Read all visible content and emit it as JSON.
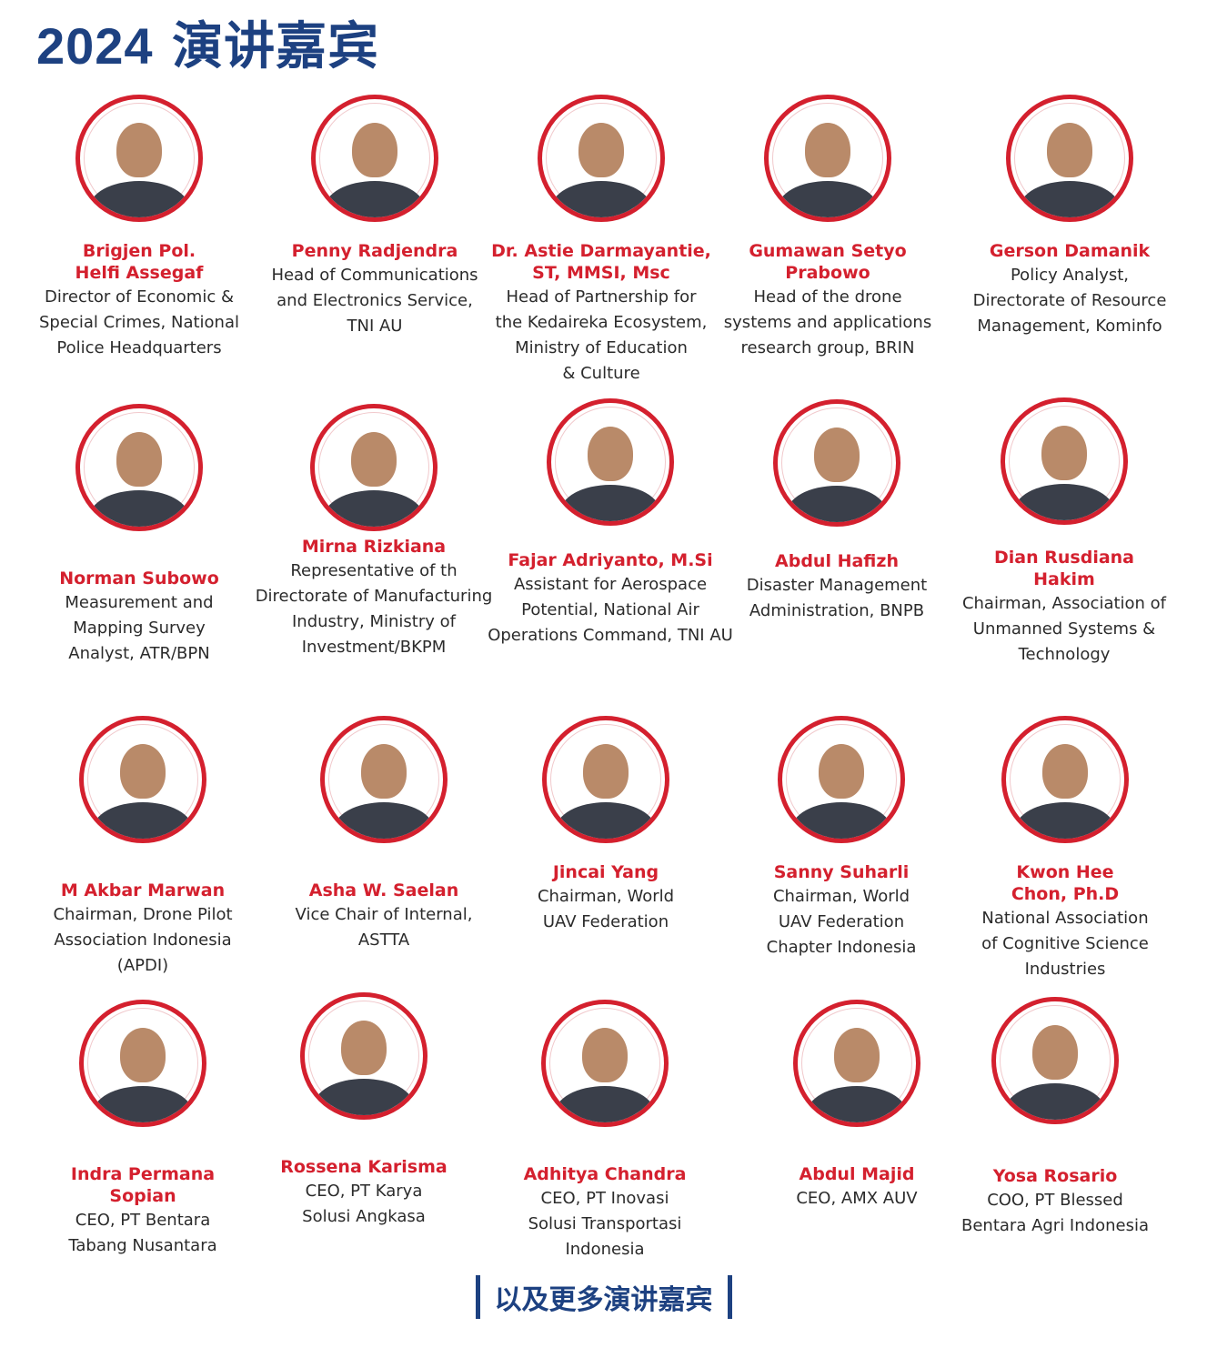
{
  "page": {
    "title_year": "2024",
    "title_text": "演讲嘉宾",
    "footer_text": "以及更多演讲嘉宾"
  },
  "colors": {
    "title": "#1d4181",
    "name": "#d4202e",
    "ring": "#d4202e"
  },
  "speakers": [
    {
      "name": "Brigjen Pol.\nHelfi Assegaf",
      "role": "Director of Economic &\nSpecial Crimes, National\nPolice Headquarters"
    },
    {
      "name": "Penny Radjendra",
      "role": "Head of Communications\nand Electronics Service,\nTNI AU"
    },
    {
      "name": "Dr. Astie Darmayantie,\nST, MMSI, Msc",
      "role": "Head of Partnership for\nthe Kedaireka Ecosystem,\nMinistry of Education\n& Culture"
    },
    {
      "name": "Gumawan Setyo\nPrabowo",
      "role": "Head of the drone\nsystems and applications\nresearch group, BRIN"
    },
    {
      "name": "Gerson Damanik",
      "role": "Policy Analyst,\nDirectorate of Resource\nManagement, Kominfo"
    },
    {
      "name": "Norman Subowo",
      "role": "Measurement and\nMapping Survey\nAnalyst, ATR/BPN"
    },
    {
      "name": "Mirna Rizkiana",
      "role": "Representative of th\nDirectorate of Manufacturing\nIndustry, Ministry of\nInvestment/BKPM"
    },
    {
      "name": "Fajar Adriyanto, M.Si",
      "role": "Assistant for Aerospace\nPotential, National Air\nOperations Command, TNI AU"
    },
    {
      "name": "Abdul Hafizh",
      "role": "Disaster Management\nAdministration, BNPB"
    },
    {
      "name": "Dian Rusdiana\nHakim",
      "role": "Chairman, Association of\nUnmanned Systems &\nTechnology"
    },
    {
      "name": "M Akbar Marwan",
      "role": "Chairman, Drone Pilot\nAssociation Indonesia\n(APDI)"
    },
    {
      "name": "Asha W. Saelan",
      "role": "Vice Chair of Internal,\nASTTA"
    },
    {
      "name": "Jincai Yang",
      "role": "Chairman, World\nUAV Federation"
    },
    {
      "name": "Sanny Suharli",
      "role": "Chairman, World\nUAV Federation\nChapter Indonesia"
    },
    {
      "name": "Kwon Hee\nChon, Ph.D",
      "role": "National Association\nof Cognitive Science\nIndustries"
    },
    {
      "name": "Indra Permana\nSopian",
      "role": "CEO, PT Bentara\nTabang Nusantara"
    },
    {
      "name": "Rossena Karisma",
      "role": "CEO, PT Karya\nSolusi Angkasa"
    },
    {
      "name": "Adhitya Chandra",
      "role": "CEO, PT Inovasi\nSolusi Transportasi\nIndonesia"
    },
    {
      "name": "Abdul Majid",
      "role": "CEO, AMX AUV"
    },
    {
      "name": "Yosa Rosario",
      "role": "COO, PT Blessed\nBentara Agri Indonesia"
    }
  ]
}
